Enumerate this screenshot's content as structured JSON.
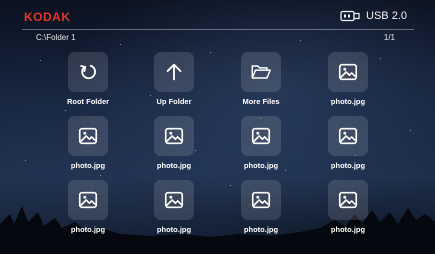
{
  "header": {
    "brand": "KODAK",
    "source_label": "USB 2.0",
    "source_icon": "usb-drive-icon",
    "brand_color": "#e2342b"
  },
  "breadcrumb": {
    "path": "C:\\Folder 1",
    "page": "1/1"
  },
  "items": [
    {
      "label": "Root Folder",
      "icon": "refresh-icon"
    },
    {
      "label": "Up Folder",
      "icon": "arrow-up-icon"
    },
    {
      "label": "More Files",
      "icon": "folder-open-icon"
    },
    {
      "label": "photo.jpg",
      "icon": "image-icon"
    },
    {
      "label": "photo.jpg",
      "icon": "image-icon"
    },
    {
      "label": "photo.jpg",
      "icon": "image-icon"
    },
    {
      "label": "photo.jpg",
      "icon": "image-icon"
    },
    {
      "label": "photo.jpg",
      "icon": "image-icon"
    },
    {
      "label": "photo.jpg",
      "icon": "image-icon"
    },
    {
      "label": "photo.jpg",
      "icon": "image-icon"
    },
    {
      "label": "photo.jpg",
      "icon": "image-icon"
    },
    {
      "label": "photo.jpg",
      "icon": "image-icon"
    }
  ]
}
